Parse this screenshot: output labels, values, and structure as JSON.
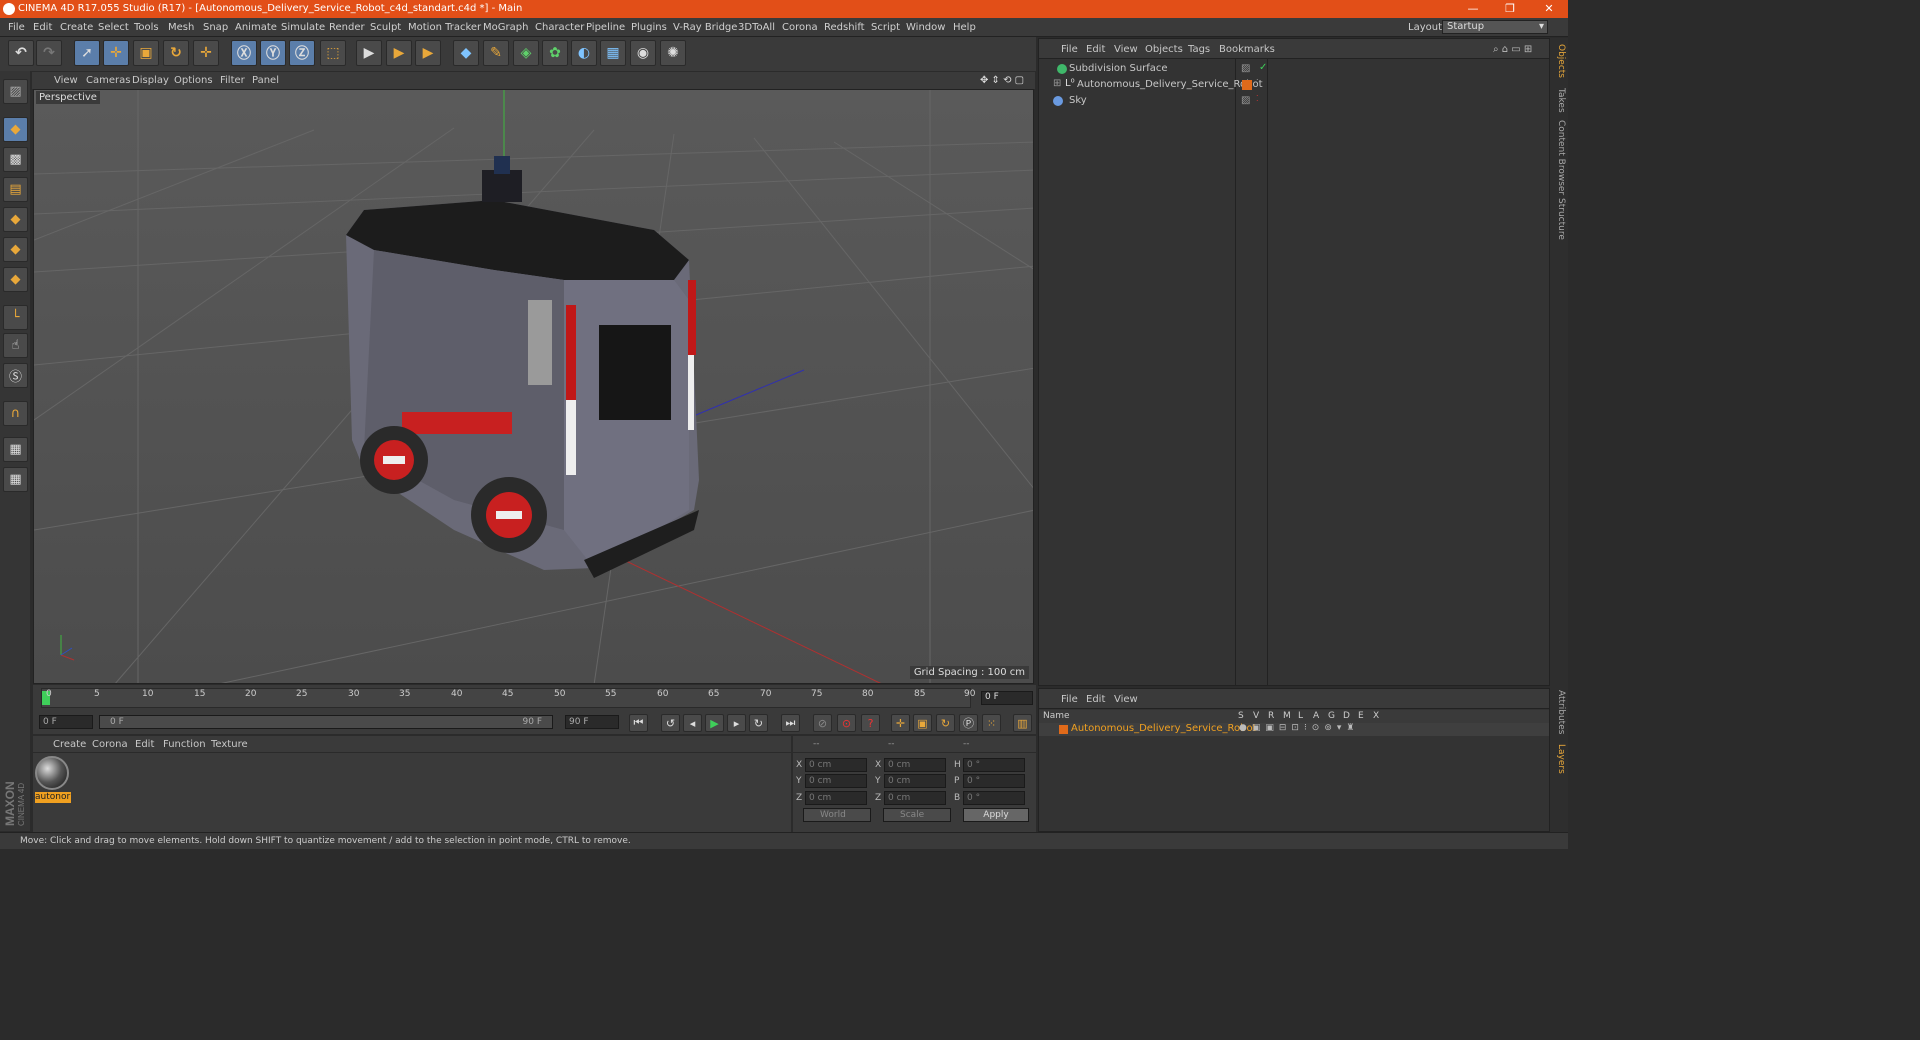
{
  "app": {
    "title": "CINEMA 4D R17.055 Studio (R17) - [Autonomous_Delivery_Service_Robot_c4d_standart.c4d *] - Main",
    "window_controls": [
      "—",
      "❐",
      "✕"
    ]
  },
  "menu": {
    "items": [
      "File",
      "Edit",
      "Create",
      "Select",
      "Tools",
      "Mesh",
      "Snap",
      "Animate",
      "Simulate",
      "Render",
      "Sculpt",
      "Motion Tracker",
      "MoGraph",
      "Character",
      "Pipeline",
      "Plugins",
      "V-Ray Bridge",
      "3DToAll",
      "Corona",
      "Redshift",
      "Script",
      "Window",
      "Help"
    ],
    "layout_label": "Layout:",
    "layout_value": "Startup"
  },
  "viewport": {
    "menu": [
      "View",
      "Cameras",
      "Display",
      "Options",
      "Filter",
      "Panel"
    ],
    "label": "Perspective",
    "grid_spacing": "Grid Spacing : 100 cm"
  },
  "timeline": {
    "ticks": [
      "0",
      "5",
      "10",
      "15",
      "20",
      "25",
      "30",
      "35",
      "40",
      "45",
      "50",
      "55",
      "60",
      "65",
      "70",
      "75",
      "80",
      "85",
      "90"
    ],
    "current_frame": "0 F",
    "start_field": "0 F",
    "range_start": "0 F",
    "range_end": "90 F",
    "end_field": "90 F"
  },
  "materials": {
    "menu": [
      "Create",
      "Corona",
      "Edit",
      "Function",
      "Texture"
    ],
    "items": [
      {
        "name": "autonor"
      }
    ]
  },
  "coords": {
    "headers": [
      "--",
      "--",
      "--"
    ],
    "rows": [
      {
        "a_label": "X",
        "a": "0 cm",
        "b_label": "X",
        "b": "0 cm",
        "c_label": "H",
        "c": "0 °"
      },
      {
        "a_label": "Y",
        "a": "0 cm",
        "b_label": "Y",
        "b": "0 cm",
        "c_label": "P",
        "c": "0 °"
      },
      {
        "a_label": "Z",
        "a": "0 cm",
        "b_label": "Z",
        "b": "0 cm",
        "c_label": "B",
        "c": "0 °"
      }
    ],
    "space": "World",
    "mode": "Scale",
    "apply": "Apply"
  },
  "objects": {
    "menu": [
      "File",
      "Edit",
      "View",
      "Objects",
      "Tags",
      "Bookmarks"
    ],
    "items": [
      {
        "name": "Subdivision Surface"
      },
      {
        "name": "Autonomous_Delivery_Service_Robot"
      },
      {
        "name": "Sky"
      }
    ]
  },
  "layers": {
    "menu": [
      "File",
      "Edit",
      "View"
    ],
    "columns": [
      "Name",
      "S",
      "V",
      "R",
      "M",
      "L",
      "A",
      "G",
      "D",
      "E",
      "X"
    ],
    "items": [
      {
        "name": "Autonomous_Delivery_Service_Robot",
        "color": "#e06a1a"
      }
    ]
  },
  "side_tabs": [
    "Objects",
    "Takes",
    "Content Browser",
    "Structure",
    "Attributes",
    "Layers"
  ],
  "status": {
    "text": "Move: Click and drag to move elements. Hold down SHIFT to quantize movement / add to the selection in point mode, CTRL to remove."
  },
  "brand": {
    "line1": "MAXON",
    "line2": "CINEMA 4D"
  },
  "colors": {
    "accent": "#e24f18",
    "highlight": "#f0a020",
    "active": "#5b7eaa"
  }
}
